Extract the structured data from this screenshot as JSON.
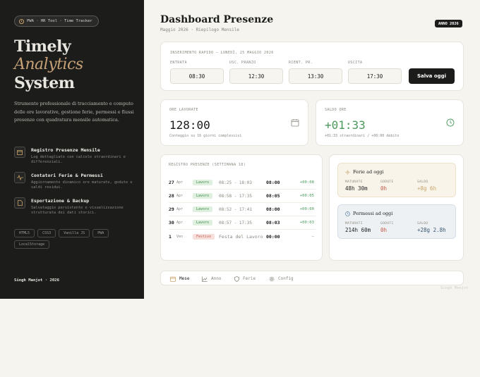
{
  "sidebar": {
    "pill": "PWA · HR Tool · Time Tracker",
    "title": [
      "Timely",
      "Analytics",
      "System"
    ],
    "description": "Strumento professionale di tracciamento e computo delle ore lavorative, gestione ferie, permessi e flussi presenze con quadratura mensile automatica.",
    "features": [
      {
        "icon": "calendar-icon",
        "title": "Registro Presenze Mensile",
        "desc": "Log dettagliato con calcolo straordinari e differenziali."
      },
      {
        "icon": "activity-icon",
        "title": "Contatori Ferie & Permessi",
        "desc": "Aggiornamento dinamico ore maturate, godute e saldi residui."
      },
      {
        "icon": "document-icon",
        "title": "Esportazione & Backup",
        "desc": "Salvataggio persistente e visualizzazione strutturata dei dati storici."
      }
    ],
    "tags": [
      "HTML5",
      "CSS3",
      "Vanilla JS",
      "PWA",
      "LocalStorage"
    ],
    "author": "Singh Manjot · 2026"
  },
  "header": {
    "title": "Dashboard Presenze",
    "subtitle": "Maggio 2026 · Riepilogo Mensile",
    "year_badge": "ANNO 2026"
  },
  "quick": {
    "heading": "INSERIMENTO RAPIDO — LUNEDÌ, 25 MAGGIO 2026",
    "fields": [
      {
        "label": "ENTRATA",
        "value": "08:30"
      },
      {
        "label": "USC. PRANZO",
        "value": "12:30"
      },
      {
        "label": "RIENT. PR.",
        "value": "13:30"
      },
      {
        "label": "USCITA",
        "value": "17:30"
      }
    ],
    "save": "Salva oggi"
  },
  "stats": {
    "worked": {
      "label": "ORE LAVORATE",
      "value": "128:00",
      "note": "Conteggio su 16 giorni complessivi"
    },
    "balance": {
      "label": "SALDO ORE",
      "value": "+01:33",
      "note": "+01:33 straordinari / +00:00 debito"
    }
  },
  "register": {
    "heading": "REGISTRO PRESENZE (SETTIMANA 18)",
    "rows": [
      {
        "day": "27",
        "month": "Apr",
        "badge": "Lavoro",
        "times": "08:25 - 18:03",
        "hours": "08:00",
        "diff": "+00:08"
      },
      {
        "day": "28",
        "month": "Apr",
        "badge": "Lavoro",
        "times": "08:58 - 17:35",
        "hours": "08:05",
        "diff": "+00:05"
      },
      {
        "day": "29",
        "month": "Apr",
        "badge": "Lavoro",
        "times": "08:52 - 17:41",
        "hours": "08:00",
        "diff": "+00:00"
      },
      {
        "day": "30",
        "month": "Apr",
        "badge": "Lavoro",
        "times": "08:57 - 17:35",
        "hours": "08:03",
        "diff": "+00:03"
      }
    ],
    "holiday": {
      "day": "1",
      "month": "Ven",
      "badge": "Festivo",
      "name": "Festa del Lavoro (P",
      "hours": "00:00",
      "diff": "—"
    }
  },
  "leave": {
    "ferie": {
      "title": "Ferie ad oggi",
      "matured_label": "MATURATE",
      "matured": "48h 30m",
      "used_label": "GODUTE",
      "used": "0h",
      "balance_label": "SALDO",
      "balance": "+8g 6h",
      "accent": "#c9a36a",
      "bg": "#f8f4ea"
    },
    "permessi": {
      "title": "Permessi ad oggi",
      "matured_label": "MATURATI",
      "matured": "214h 60m",
      "used_label": "GODUTI",
      "used": "0h",
      "balance_label": "SALDO",
      "balance": "+28g 2.8h",
      "accent": "#5b7fa6",
      "bg": "#eef1f4"
    }
  },
  "nav": {
    "items": [
      "Mese",
      "Anno",
      "Ferie",
      "Config"
    ],
    "active": "Mese"
  },
  "watermark": "Singh Manjot",
  "colors": {
    "green": "#4a9a5c",
    "red": "#c1584a",
    "blue": "#35546f",
    "gold": "#c9a36a",
    "dark": "#1c1c1b"
  }
}
